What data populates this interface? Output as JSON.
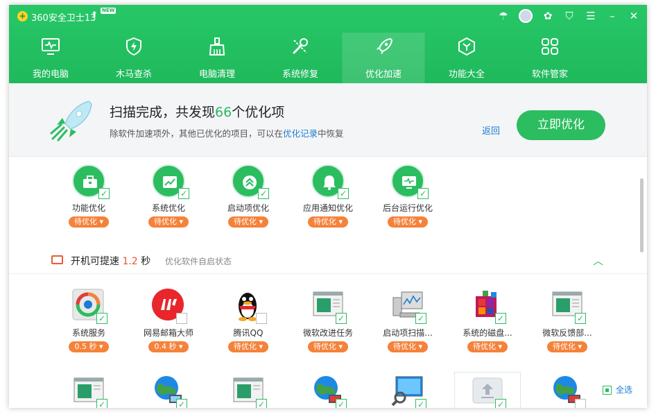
{
  "app": {
    "title": "360安全卫士13",
    "badge": "NEW"
  },
  "titlebar_icons": [
    "umbrella-icon",
    "avatar",
    "skin-icon",
    "shirt-icon",
    "menu-icon",
    "minimize-icon",
    "close-icon"
  ],
  "nav": [
    {
      "label": "我的电脑",
      "icon": "monitor-icon"
    },
    {
      "label": "木马查杀",
      "icon": "shield-icon"
    },
    {
      "label": "电脑清理",
      "icon": "broom-icon"
    },
    {
      "label": "系统修复",
      "icon": "wrench-icon"
    },
    {
      "label": "优化加速",
      "icon": "rocket-icon",
      "active": true
    },
    {
      "label": "功能大全",
      "icon": "hexagon-icon"
    },
    {
      "label": "软件管家",
      "icon": "apps-icon"
    }
  ],
  "header": {
    "title_prefix": "扫描完成，共发现",
    "count": "66",
    "title_suffix": "个优化项",
    "sub_prefix": "除软件加速项外，其他已优化的项目，可以在",
    "sub_link": "优化记录",
    "sub_suffix": "中恢复",
    "back": "返回",
    "optimize_button": "立即优化"
  },
  "categories": [
    {
      "label": "功能优化",
      "status": "待优化"
    },
    {
      "label": "系统优化",
      "status": "待优化"
    },
    {
      "label": "启动项优化",
      "status": "待优化"
    },
    {
      "label": "应用通知优化",
      "status": "待优化"
    },
    {
      "label": "后台运行优化",
      "status": "待优化"
    }
  ],
  "section": {
    "title": "开机可提速",
    "value": "1.2",
    "unit": "秒",
    "subtitle": "优化软件自启状态"
  },
  "apps_row1": [
    {
      "label": "系统服务",
      "status": "0.5 秒",
      "checked": true
    },
    {
      "label": "网易邮箱大师",
      "status": "0.4 秒",
      "checked": false
    },
    {
      "label": "腾讯QQ",
      "status": "待优化",
      "checked": false
    },
    {
      "label": "微软改进任务",
      "status": "待优化",
      "checked": true
    },
    {
      "label": "启动项扫描...",
      "status": "待优化",
      "checked": true
    },
    {
      "label": "系统的磁盘...",
      "status": "待优化",
      "checked": true
    },
    {
      "label": "微软反馈部...",
      "status": "待优化",
      "checked": true
    }
  ],
  "select_all": "全选",
  "colors": {
    "brand_green": "#2bbd60",
    "orange": "#f5823a",
    "link_blue": "#1b7bd4"
  }
}
